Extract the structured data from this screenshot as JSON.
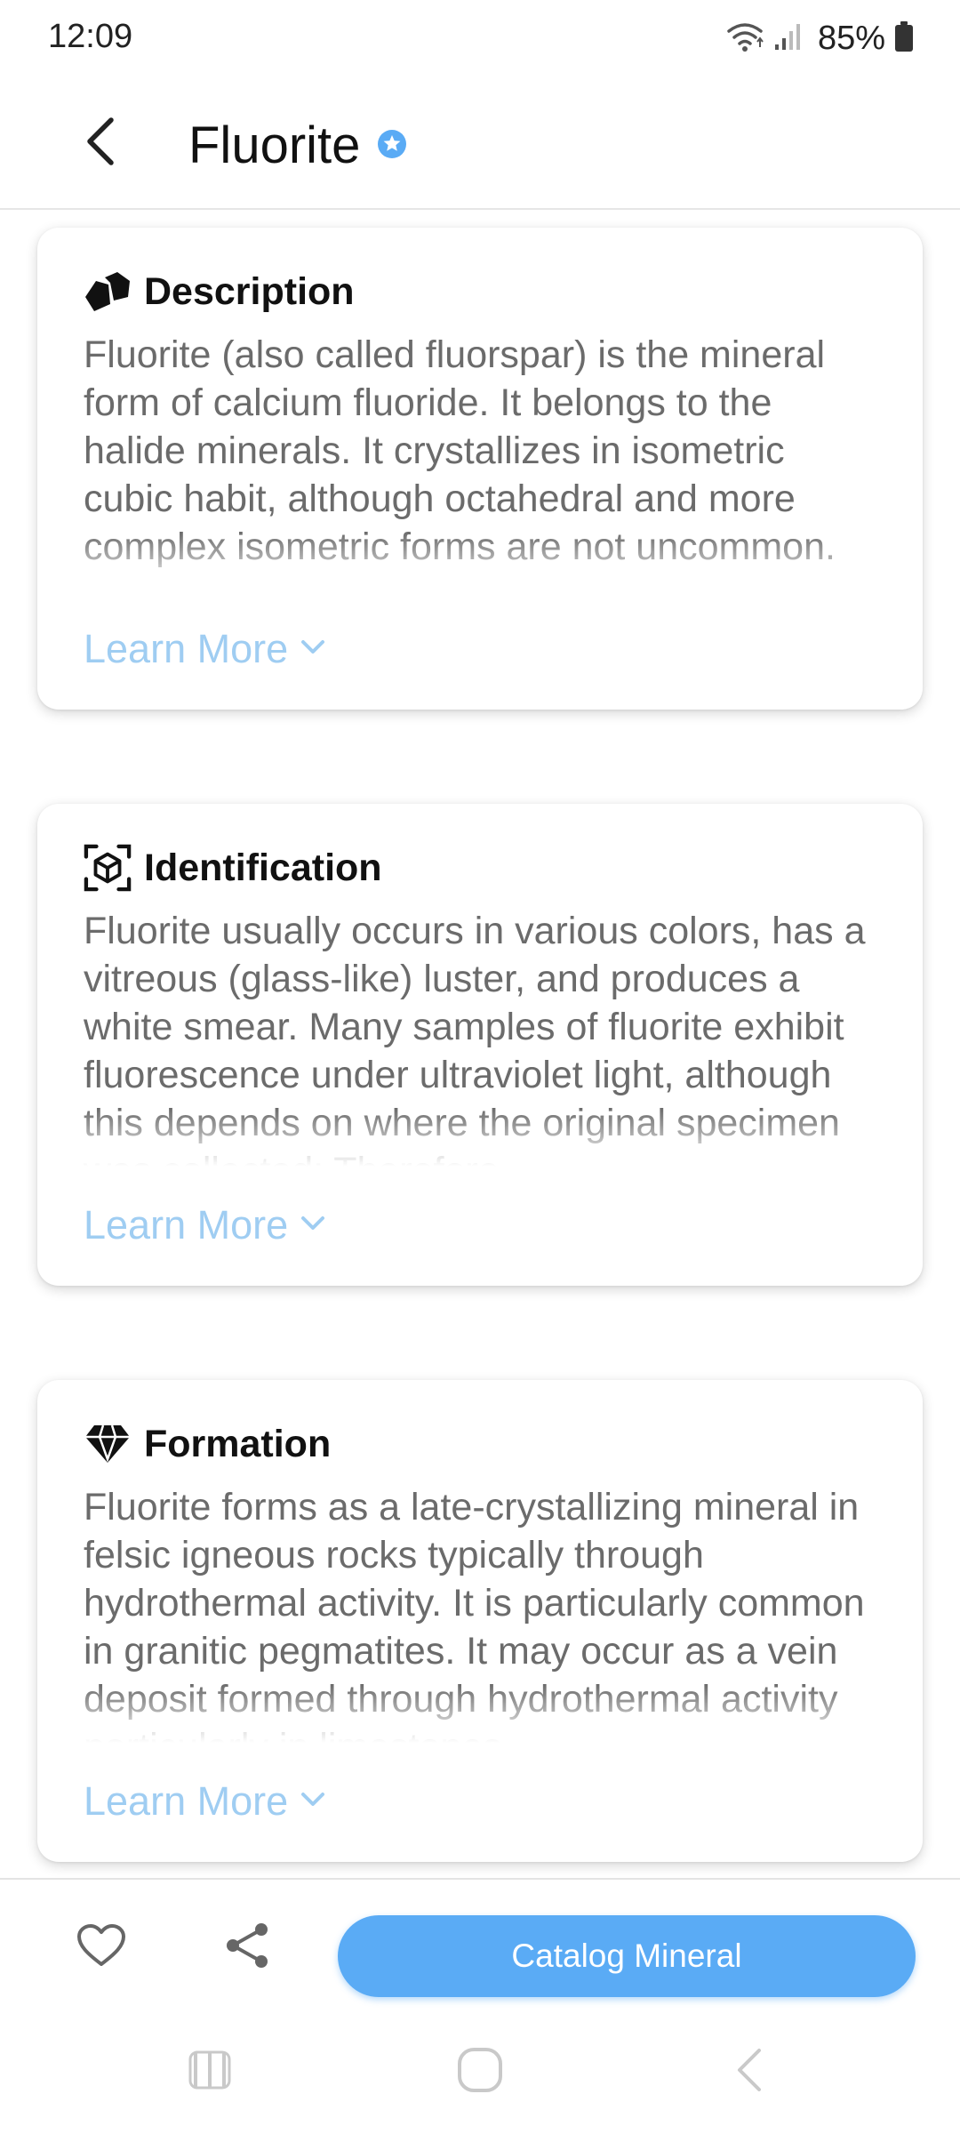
{
  "status_bar": {
    "time": "12:09",
    "battery_percent": "85%",
    "icons": [
      "wifi-icon",
      "signal-icon",
      "battery-icon"
    ]
  },
  "header": {
    "title": "Fluorite",
    "back_icon": "chevron-left-icon",
    "badge_icon": "verified-star-icon"
  },
  "cards": [
    {
      "icon": "rock-icon",
      "title": "Description",
      "body": "Fluorite (also called fluorspar) is the mineral form of calcium fluoride. It belongs to the halide minerals. It crystallizes in isometric cubic habit, although octahedral and more complex isometric forms are not uncommon.",
      "link": "Learn More"
    },
    {
      "icon": "scan-cube-icon",
      "title": "Identification",
      "body": "Fluorite usually occurs in various colors, has a vitreous (glass-like) luster, and produces a white smear. Many samples of fluorite exhibit fluorescence under ultraviolet light, although this depends on where the original specimen was collected; Therefore,",
      "link": "Learn More"
    },
    {
      "icon": "gem-icon",
      "title": "Formation",
      "body": "Fluorite forms as a late-crystallizing mineral in felsic igneous rocks typically through hydrothermal activity. It is particularly common in granitic pegmatites. It may occur as a vein deposit formed through hydrothermal activity particularly in limestones",
      "link": "Learn More"
    }
  ],
  "action_bar": {
    "catalog_label": "Catalog Mineral",
    "favorite_icon": "heart-icon",
    "share_icon": "share-icon"
  },
  "system_nav": [
    "recents-icon",
    "home-icon",
    "back-icon"
  ],
  "colors": {
    "accent": "#5aabf5",
    "link": "#9fcdf2",
    "badge": "#5aabf5",
    "body_text": "#6b6b6b"
  }
}
